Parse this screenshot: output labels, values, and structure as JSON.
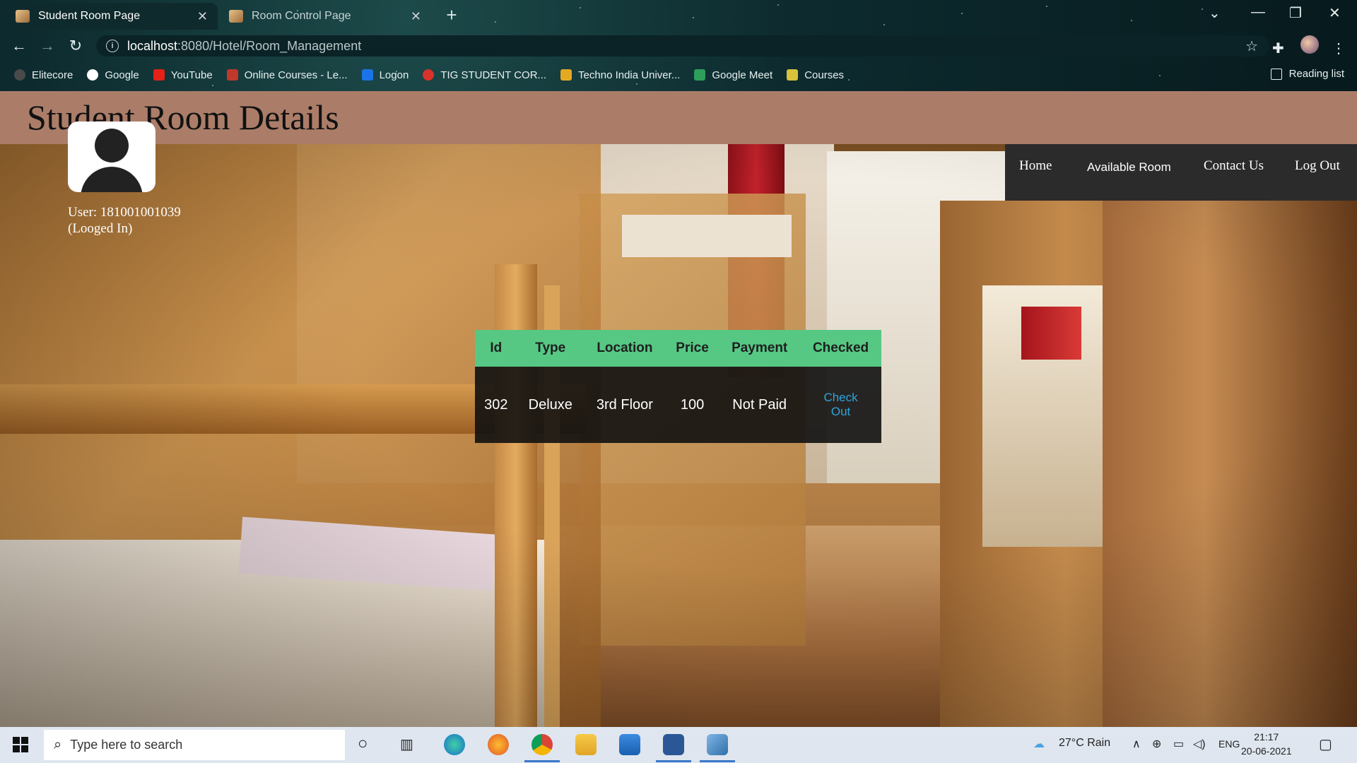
{
  "browser": {
    "tabs": [
      {
        "title": "Student Room Page",
        "active": true
      },
      {
        "title": "Room Control Page",
        "active": false
      }
    ],
    "url_host": "localhost",
    "url_path": ":8080/Hotel/Room_Management",
    "bookmarks": [
      {
        "label": "Elitecore",
        "color": "#3b3b3b"
      },
      {
        "label": "Google",
        "color": "#ffffff"
      },
      {
        "label": "YouTube",
        "color": "#e62117"
      },
      {
        "label": "Online Courses - Le...",
        "color": "#c0392b"
      },
      {
        "label": "Logon",
        "color": "#1a73e8"
      },
      {
        "label": "TIG STUDENT COR...",
        "color": "#d9322b"
      },
      {
        "label": "Techno India Univer...",
        "color": "#e5a823"
      },
      {
        "label": "Google Meet",
        "color": "#2e9e5b"
      },
      {
        "label": "Courses",
        "color": "#d7c23a"
      }
    ],
    "reading_list": "Reading list"
  },
  "page": {
    "title": "Student Room Details",
    "user_line": "User: 181001001039",
    "status_line": "(Looged In)",
    "nav": {
      "home": "Home",
      "available_room": "Available Room",
      "contact_us": "Contact Us",
      "log_out": "Log Out"
    },
    "table": {
      "headers": [
        "Id",
        "Type",
        "Location",
        "Price",
        "Payment",
        "Checked"
      ],
      "row": {
        "id": "302",
        "type": "Deluxe",
        "location": "3rd Floor",
        "price": "100",
        "payment": "Not Paid",
        "action": "Check Out"
      }
    }
  },
  "taskbar": {
    "search_placeholder": "Type here to search",
    "weather": "27°C  Rain",
    "language": "ENG",
    "time": "21:17",
    "date": "20-06-2021"
  },
  "colors": {
    "header_bg": "#ab7d69",
    "table_header_bg": "#56c884",
    "nav_bg": "#2c2b2b",
    "link": "#2fa5d8"
  }
}
